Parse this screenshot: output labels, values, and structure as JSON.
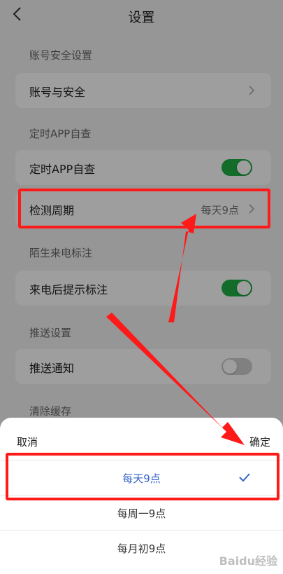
{
  "header": {
    "title": "设置"
  },
  "sections": [
    {
      "label": "账号安全设置",
      "row": {
        "label": "账号与安全",
        "type": "nav"
      }
    },
    {
      "label": "定时APP自查",
      "rows": [
        {
          "label": "定时APP自查",
          "type": "toggle",
          "on": true
        },
        {
          "label": "检测周期",
          "type": "nav",
          "value": "每天9点"
        }
      ]
    },
    {
      "label": "陌生来电标注",
      "row": {
        "label": "来电后提示标注",
        "type": "toggle",
        "on": true
      }
    },
    {
      "label": "推送设置",
      "row": {
        "label": "推送通知",
        "type": "toggle",
        "on": false
      }
    },
    {
      "label": "清除缓存"
    }
  ],
  "sheet": {
    "cancel_label": "取消",
    "confirm_label": "确定",
    "options": [
      {
        "label": "每天9点",
        "selected": true
      },
      {
        "label": "每周一9点",
        "selected": false
      },
      {
        "label": "每月初9点",
        "selected": false
      }
    ]
  },
  "colors": {
    "accent": "#3563c9",
    "toggle_on": "#1fae45",
    "annotation": "#ff1a1a"
  },
  "watermark": "Baidu经验"
}
